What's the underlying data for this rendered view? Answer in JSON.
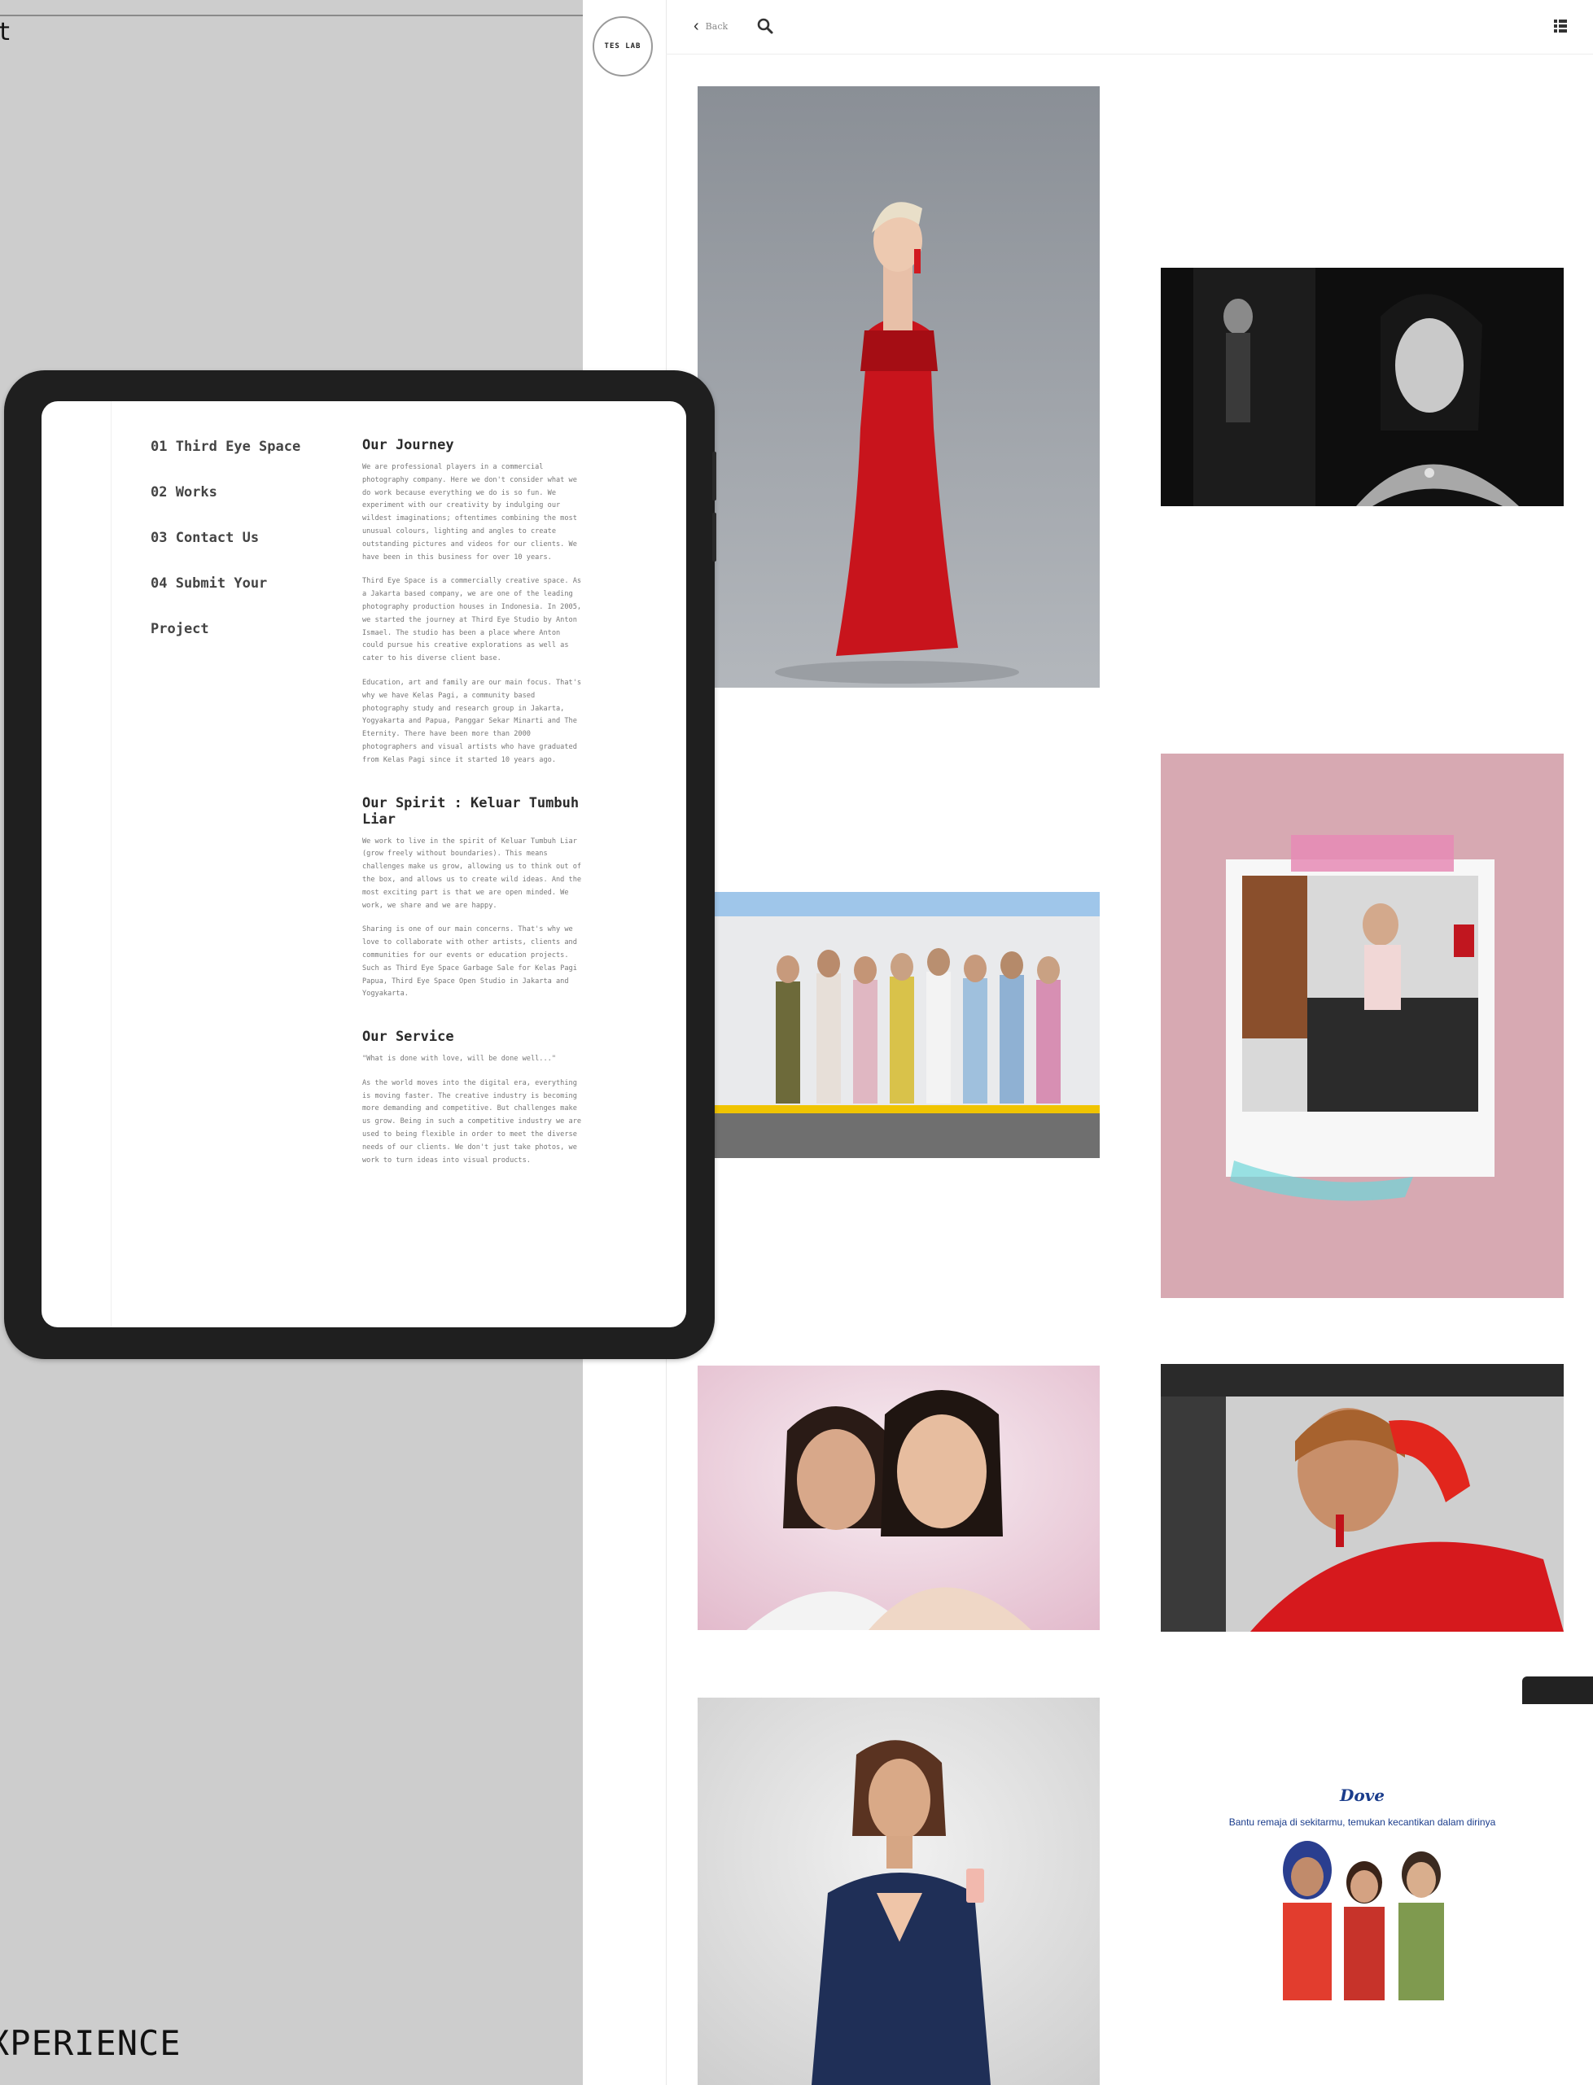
{
  "background": {
    "corner_letter": "t",
    "footer_text": "XPERIENCE",
    "color": "#cdcdcd"
  },
  "website": {
    "logo_text": "TES LAB",
    "topbar": {
      "back_label": "Back",
      "icons": [
        "chevron-left-icon",
        "search-icon",
        "grid-menu-icon"
      ]
    },
    "gallery": [
      {
        "name": "red-gown-portrait",
        "desc": "woman in red strapless gown"
      },
      {
        "name": "black-white-portrait",
        "desc": "black and white portrait with necklace"
      },
      {
        "name": "group-photo",
        "desc": "group of women outdoors"
      },
      {
        "name": "polaroid-kitchen",
        "desc": "polaroid on pink background"
      },
      {
        "name": "two-women-beauty",
        "desc": "two women beauty shot"
      },
      {
        "name": "lipstick-car",
        "desc": "woman applying lipstick in car"
      },
      {
        "name": "navy-suit-portrait",
        "desc": "woman in navy suit holding phone"
      },
      {
        "name": "dove-ad",
        "desc": "Dove advertisement"
      }
    ],
    "dove_ad": {
      "brand": "Dove",
      "headline": "Bantu remaja di sekitarmu, temukan kecantikan dalam dirinya"
    }
  },
  "tablet": {
    "nav": [
      {
        "label": "01 Third Eye Space"
      },
      {
        "label": "02 Works"
      },
      {
        "label": "03 Contact Us"
      },
      {
        "label": "04 Submit Your"
      },
      {
        "label": "Project"
      }
    ],
    "sections": [
      {
        "title": "Our Journey",
        "paragraphs": [
          "We are professional players in a commercial photography company. Here we don't consider what we do work because everything we do is so fun. We experiment with our creativity by indulging our wildest imaginations; oftentimes combining the most unusual colours, lighting and angles to create outstanding pictures and videos for our clients. We have been in this business for over 10 years.",
          "Third Eye Space is a commercially creative space. As a Jakarta based company, we are one of the leading photography production houses in Indonesia. In 2005, we started the journey at Third Eye Studio by Anton Ismael. The studio has been a place where Anton could pursue his creative explorations as well as cater to his diverse client base.",
          "Education, art and family are our main focus. That's why we have Kelas Pagi, a community based photography study and research group in Jakarta, Yogyakarta and Papua, Panggar Sekar Minarti and The Eternity. There have been more than 2000 photographers and visual artists who have graduated from Kelas Pagi since it started 10 years ago."
        ]
      },
      {
        "title": "Our Spirit : Keluar Tumbuh Liar",
        "paragraphs": [
          "We work to live in the spirit of Keluar Tumbuh Liar (grow freely without boundaries). This means challenges make us grow, allowing us to think out of the box, and allows us to create wild ideas. And the most exciting part is that we are open minded. We work, we share and we are happy.",
          "Sharing is one of our main concerns. That's why we love to collaborate with other artists, clients and communities for our events or education projects. Such as Third Eye Space Garbage Sale for Kelas Pagi Papua, Third Eye Space Open Studio in Jakarta and Yogyakarta."
        ]
      },
      {
        "title": "Our Service",
        "paragraphs": [
          "\"What is done with love, will be done well...\"",
          "As the world moves into the digital era, everything is moving faster. The creative industry is becoming more demanding and competitive. But challenges make us grow. Being in such a competitive industry we are used to being flexible in order to meet the diverse needs of our clients. We don't just take photos, we work to turn ideas into visual products."
        ]
      }
    ]
  }
}
